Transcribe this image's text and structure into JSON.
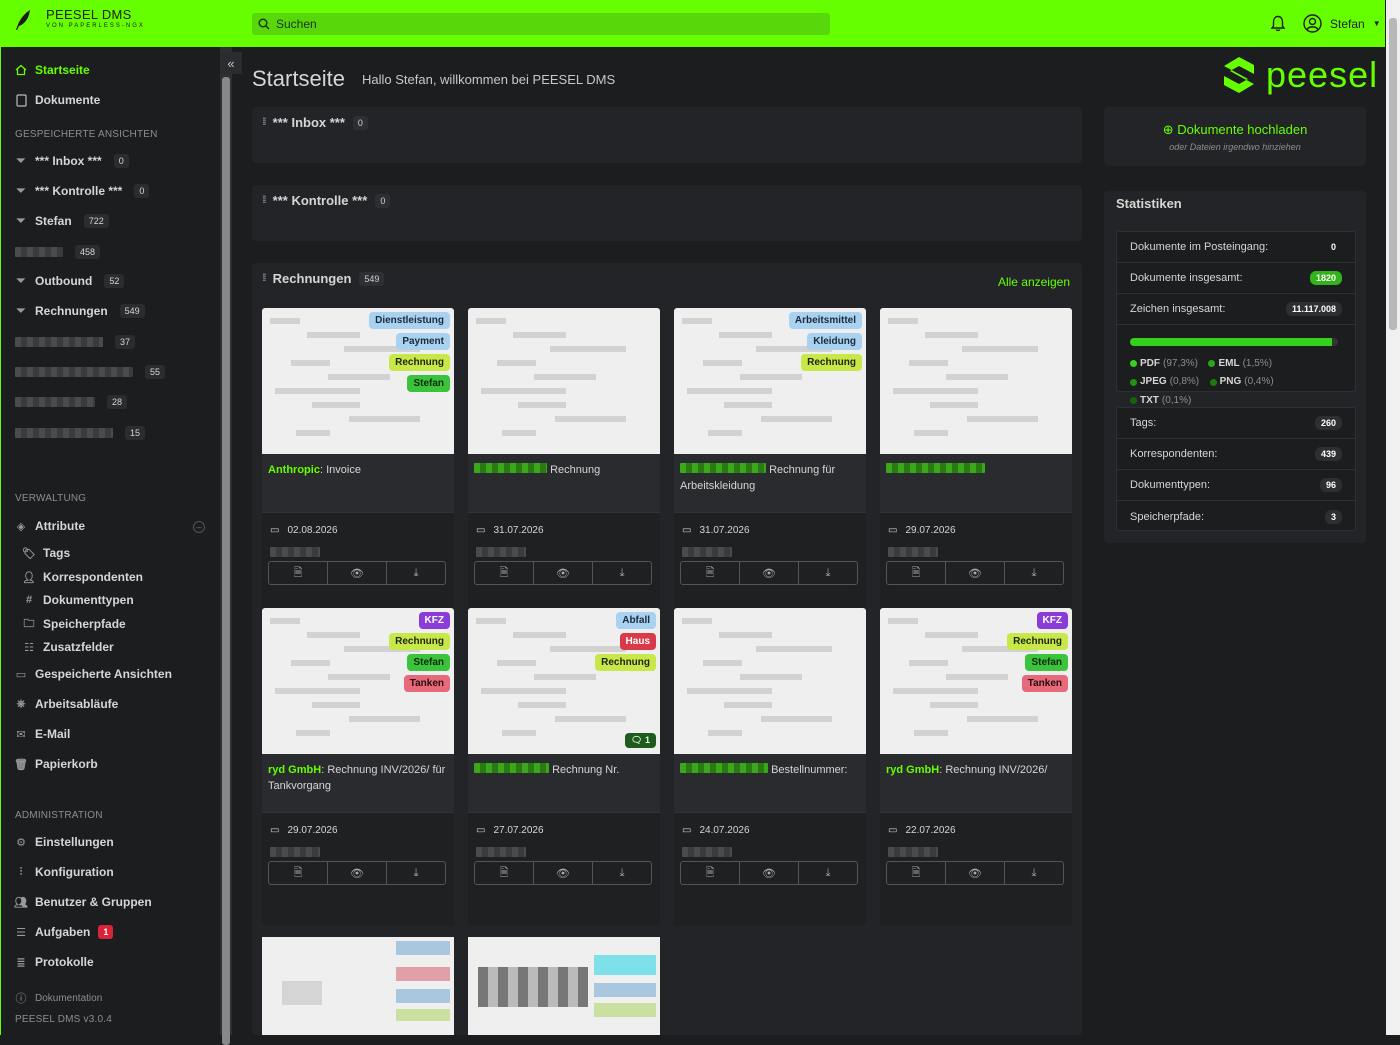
{
  "brand": {
    "name": "PEESEL DMS",
    "tagline": "VON PAPERLESS-NGX"
  },
  "search": {
    "placeholder": "Suchen"
  },
  "user": {
    "name": "Stefan"
  },
  "colors": {
    "accent": "#66ff00",
    "background": "#1c1d1f",
    "panel": "#232427"
  },
  "sidebar": {
    "main": [
      {
        "label": "Startseite",
        "icon": "home-icon",
        "active": true
      },
      {
        "label": "Dokumente",
        "icon": "file-icon"
      }
    ],
    "saved_views_header": "GESPEICHERTE ANSICHTEN",
    "saved_views": [
      {
        "label": "*** Inbox ***",
        "count": "0"
      },
      {
        "label": "*** Kontrolle ***",
        "count": "0"
      },
      {
        "label": "Stefan",
        "count": "722"
      },
      {
        "label": "",
        "count": "458"
      },
      {
        "label": "Outbound",
        "count": "52"
      },
      {
        "label": "Rechnungen",
        "count": "549"
      },
      {
        "label": "",
        "count": "37"
      },
      {
        "label": "",
        "count": "55"
      },
      {
        "label": "",
        "count": "28"
      },
      {
        "label": "",
        "count": "15"
      }
    ],
    "admin_header": "VERWALTUNG",
    "attribute": "Attribute",
    "attribute_sub": [
      "Tags",
      "Korrespondenten",
      "Dokumenttypen",
      "Speicherpfade",
      "Zusatzfelder"
    ],
    "manage": [
      "Gespeicherte Ansichten",
      "Arbeitsabläufe",
      "E-Mail",
      "Papierkorb"
    ],
    "administration_header": "ADMINISTRATION",
    "administration": [
      "Einstellungen",
      "Konfiguration",
      "Benutzer & Gruppen",
      "Aufgaben",
      "Protokolle"
    ],
    "tasks_badge": "1",
    "footer_doc": "Dokumentation",
    "footer_version": "PEESEL DMS v3.0.4"
  },
  "main": {
    "title": "Startseite",
    "subtitle": "Hallo Stefan, willkommen bei PEESEL DMS",
    "logo_word": "peesel"
  },
  "panels": {
    "inbox": {
      "title": "*** Inbox ***",
      "count": "0"
    },
    "kontrolle": {
      "title": "*** Kontrolle ***",
      "count": "0"
    },
    "rechnungen": {
      "title": "Rechnungen",
      "count": "549",
      "show_all": "Alle anzeigen"
    }
  },
  "cards": [
    {
      "correspondent": "Anthropic",
      "title": "Invoice",
      "date": "02.08.2026",
      "tags": [
        [
          "Dienstleistung",
          "t-blue"
        ],
        [
          "Payment",
          "t-blue"
        ],
        [
          "Rechnung",
          "t-yel"
        ],
        [
          "Stefan",
          "t-grn"
        ]
      ]
    },
    {
      "correspondent": "",
      "title": "Rechnung",
      "date": "31.07.2026",
      "tags": []
    },
    {
      "correspondent": "",
      "title": "Rechnung für Arbeitskleidung",
      "date": "31.07.2026",
      "tags": [
        [
          "Arbeitsmittel",
          "t-blue"
        ],
        [
          "Kleidung",
          "t-blue"
        ],
        [
          "Rechnung",
          "t-yel"
        ]
      ]
    },
    {
      "correspondent": "",
      "title": "",
      "date": "29.07.2026",
      "tags": []
    },
    {
      "correspondent": "ryd GmbH",
      "title": "Rechnung INV/2026/ für Tankvorgang",
      "date": "29.07.2026",
      "tags": [
        [
          "KFZ",
          "t-purp"
        ],
        [
          "Rechnung",
          "t-yel"
        ],
        [
          "Stefan",
          "t-grn"
        ],
        [
          "Tanken",
          "t-pink"
        ]
      ]
    },
    {
      "correspondent": "",
      "title": "Rechnung Nr.",
      "date": "27.07.2026",
      "tags": [
        [
          "Abfall",
          "t-blue"
        ],
        [
          "Haus",
          "t-red"
        ],
        [
          "Rechnung",
          "t-yel"
        ]
      ],
      "notes": "1"
    },
    {
      "correspondent": "",
      "title": "Bestellnummer:",
      "date": "24.07.2026",
      "tags": []
    },
    {
      "correspondent": "ryd GmbH",
      "title": "Rechnung INV/2026/",
      "date": "22.07.2026",
      "tags": [
        [
          "KFZ",
          "t-purp"
        ],
        [
          "Rechnung",
          "t-yel"
        ],
        [
          "Stefan",
          "t-grn"
        ],
        [
          "Tanken",
          "t-pink"
        ]
      ]
    }
  ],
  "upload": {
    "label": "Dokumente hochladen",
    "hint": "oder Dateien irgendwo hinziehen"
  },
  "stats": {
    "title": "Statistiken",
    "inbox_label": "Dokumente im Posteingang:",
    "inbox_value": "0",
    "total_label": "Dokumente insgesamt:",
    "total_value": "1820",
    "chars_label": "Zeichen insgesamt:",
    "chars_value": "11.117.008",
    "filetypes": [
      {
        "name": "PDF",
        "pct": "(97,3%)",
        "fraction": 0.973
      },
      {
        "name": "EML",
        "pct": "(1,5%)",
        "fraction": 0.015
      },
      {
        "name": "JPEG",
        "pct": "(0,8%)",
        "fraction": 0.008
      },
      {
        "name": "PNG",
        "pct": "(0,4%)",
        "fraction": 0.004
      },
      {
        "name": "TXT",
        "pct": "(0,1%)",
        "fraction": 0.001
      }
    ],
    "tags_label": "Tags:",
    "tags_value": "260",
    "corr_label": "Korrespondenten:",
    "corr_value": "439",
    "types_label": "Dokumenttypen:",
    "types_value": "96",
    "paths_label": "Speicherpfade:",
    "paths_value": "3"
  }
}
